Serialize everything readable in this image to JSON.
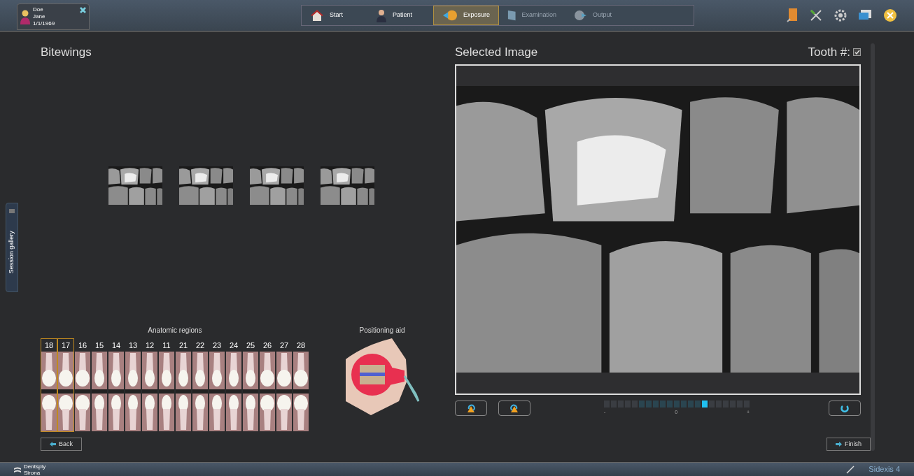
{
  "patient": {
    "last_name": "Doe",
    "first_name": "Jane",
    "birth_date": "1/1/1969"
  },
  "workflow": [
    {
      "label": "Start",
      "kind": "home",
      "selected": false,
      "disabled": false
    },
    {
      "label": "Patient",
      "kind": "person",
      "selected": false,
      "disabled": false
    },
    {
      "label": "Exposure",
      "kind": "exposure",
      "selected": true,
      "disabled": false
    },
    {
      "label": "Examination",
      "kind": "exam",
      "selected": false,
      "disabled": true
    },
    {
      "label": "Output",
      "kind": "output",
      "selected": false,
      "disabled": true
    }
  ],
  "session_gallery": {
    "label": "Session gallery"
  },
  "left_panel": {
    "title": "Bitewings",
    "thumbnails": [
      {
        "kind": "bitewing"
      },
      {
        "kind": "bitewing"
      },
      {
        "kind": "bitewing"
      },
      {
        "kind": "bitewing"
      }
    ]
  },
  "anatomic_regions": {
    "title": "Anatomic regions",
    "teeth": [
      {
        "number": "18",
        "selected": true
      },
      {
        "number": "17",
        "selected": true
      },
      {
        "number": "16",
        "selected": false
      },
      {
        "number": "15",
        "selected": false
      },
      {
        "number": "14",
        "selected": false
      },
      {
        "number": "13",
        "selected": false
      },
      {
        "number": "12",
        "selected": false
      },
      {
        "number": "11",
        "selected": false
      },
      {
        "number": "21",
        "selected": false
      },
      {
        "number": "22",
        "selected": false
      },
      {
        "number": "23",
        "selected": false
      },
      {
        "number": "24",
        "selected": false
      },
      {
        "number": "25",
        "selected": false
      },
      {
        "number": "26",
        "selected": false
      },
      {
        "number": "27",
        "selected": false
      },
      {
        "number": "28",
        "selected": false
      }
    ]
  },
  "positioning_aid": {
    "title": "Positioning aid"
  },
  "back_button": "Back",
  "selected_image": {
    "title": "Selected Image",
    "tooth_label": "Tooth #:",
    "tooth_checked": true
  },
  "contrast_slider": {
    "level": 0.7,
    "min_label": "-",
    "mid_label": "0",
    "max_label": "+"
  },
  "finish_button": "Finish",
  "footer": {
    "brand": "Dentsply Sirona",
    "product": "Sidexis 4"
  }
}
